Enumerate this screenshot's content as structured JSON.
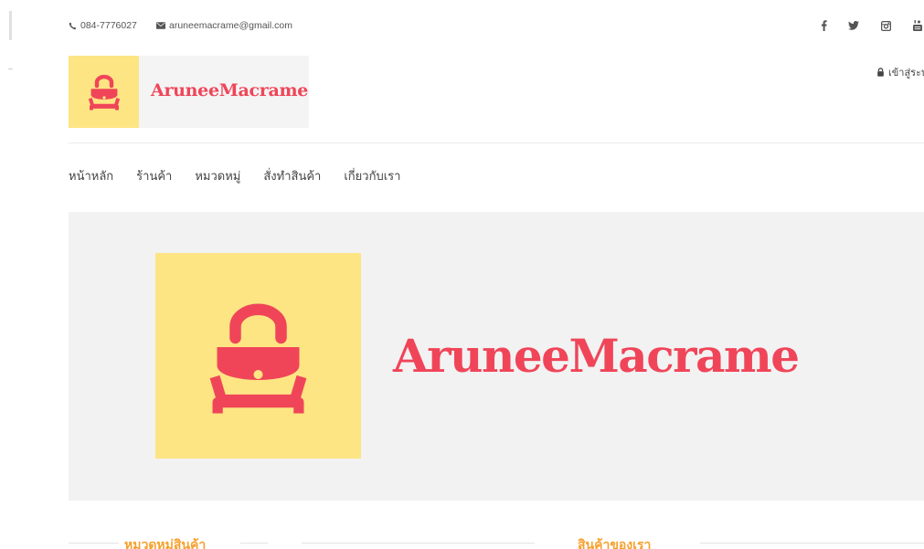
{
  "topbar": {
    "phone": "084-7776027",
    "email": "aruneemacrame@gmail.com",
    "social_icons": [
      "facebook-icon",
      "twitter-icon",
      "instagram-icon",
      "youtube-icon"
    ]
  },
  "header": {
    "logo_text": "AruneeMacrame",
    "login_label": "เข้าสู่ระบ"
  },
  "nav": {
    "items": [
      "หน้าหลัก",
      "ร้านค้า",
      "หมวดหมู่",
      "สั่งทำสินค้า",
      "เกี่ยวกับเรา"
    ]
  },
  "hero": {
    "brand_text": "AruneeMacrame"
  },
  "sections": {
    "categories_title": "หมวดหมู่สินค้า",
    "products_title": "สินค้าของเรา"
  },
  "colors": {
    "brand_red": "#f04559",
    "logo_yellow": "#fde583",
    "accent_orange": "#f5a12e",
    "hero_bg": "#f2f2f2"
  }
}
